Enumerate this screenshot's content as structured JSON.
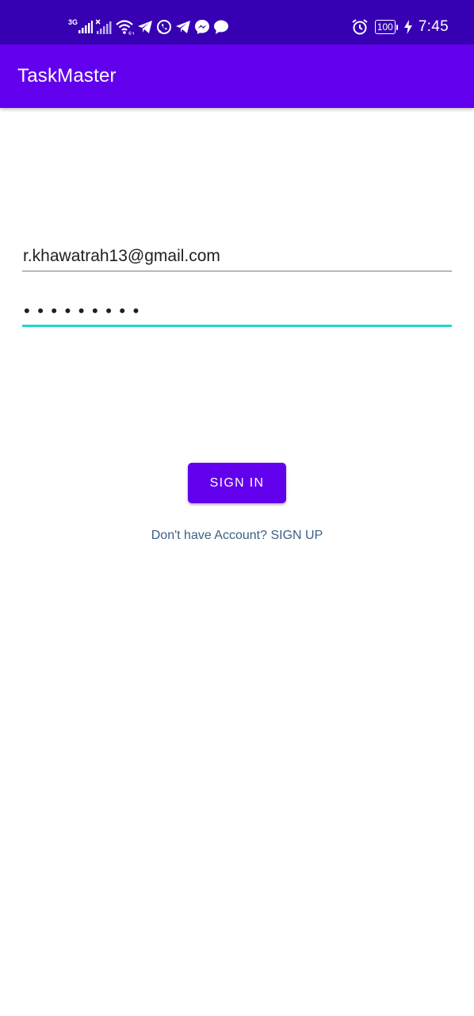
{
  "status_bar": {
    "network_label": "3G",
    "time": "7:45",
    "battery": "100",
    "icons": [
      "signal-icon",
      "signal-no-service-icon",
      "wifi-icon",
      "telegram-icon",
      "whatsapp-icon",
      "telegram-icon",
      "messenger-icon",
      "chat-bubble-icon",
      "alarm-icon",
      "battery-icon",
      "charging-icon"
    ]
  },
  "app_bar": {
    "title": "TaskMaster"
  },
  "form": {
    "email_value": "r.khawatrah13@gmail.com",
    "password_mask": "•••••••••"
  },
  "actions": {
    "signin_label": "SIGN IN",
    "signup_prompt": "Don't have Account? SIGN UP"
  },
  "colors": {
    "status_bar": "#3700B3",
    "primary": "#6200EE",
    "focus_underline": "#1ED8C4",
    "link": "#3D5F86"
  }
}
